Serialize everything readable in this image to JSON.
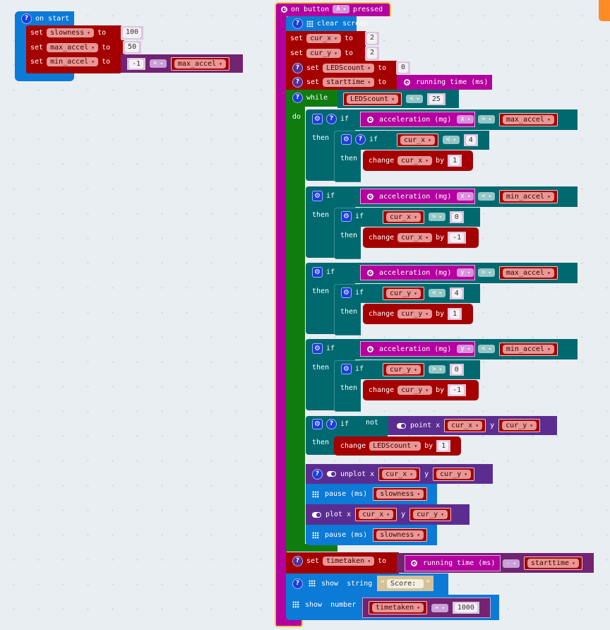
{
  "on_start": {
    "label": "on start",
    "statements": [
      {
        "keyword": "set",
        "var": "slowness",
        "to": "to",
        "value": "100"
      },
      {
        "keyword": "set",
        "var": "max_accel",
        "to": "to",
        "value": "50"
      },
      {
        "keyword": "set",
        "var": "min_accel",
        "to": "to",
        "left": "-1",
        "op": "×",
        "right_var": "max_accel"
      }
    ]
  },
  "on_button": {
    "prefix": "on button",
    "button": "A",
    "suffix": "pressed",
    "clear_screen": "clear screen",
    "set_cur_x": {
      "keyword": "set",
      "var": "cur_x",
      "to": "to",
      "value": "2"
    },
    "set_cur_y": {
      "keyword": "set",
      "var": "cur_y",
      "to": "to",
      "value": "2"
    },
    "set_leds": {
      "keyword": "set",
      "var": "LEDScount",
      "to": "to",
      "value": "0"
    },
    "set_start": {
      "keyword": "set",
      "var": "starttime",
      "to": "to",
      "value": "running time (ms)"
    },
    "while": {
      "keyword": "while",
      "var": "LEDScount",
      "op": "<",
      "value": "25",
      "do": "do"
    },
    "ifs": [
      {
        "if": "if",
        "sensor": "acceleration (mg)",
        "axis": "x",
        "op": ">",
        "cmp_var": "max_accel",
        "then": "then",
        "inner": {
          "if": "if",
          "var": "cur_x",
          "op": "<",
          "value": "4",
          "then": "then",
          "change": "change",
          "by": "by",
          "delta": "1"
        }
      },
      {
        "if": "if",
        "sensor": "acceleration (mg)",
        "axis": "x",
        "op": "<",
        "cmp_var": "min_accel",
        "then": "then",
        "inner": {
          "if": "if",
          "var": "cur_x",
          "op": ">",
          "value": "0",
          "then": "then",
          "change": "change",
          "by": "by",
          "delta": "-1"
        }
      },
      {
        "if": "if",
        "sensor": "acceleration (mg)",
        "axis": "y",
        "op": ">",
        "cmp_var": "max_accel",
        "then": "then",
        "inner": {
          "if": "if",
          "var": "cur_y",
          "op": "<",
          "value": "4",
          "then": "then",
          "change": "change",
          "by": "by",
          "delta": "1"
        }
      },
      {
        "if": "if",
        "sensor": "acceleration (mg)",
        "axis": "y",
        "op": "<",
        "cmp_var": "min_accel",
        "then": "then",
        "inner": {
          "if": "if",
          "var": "cur_y",
          "op": ">",
          "value": "0",
          "then": "then",
          "change": "change",
          "by": "by",
          "delta": "-1"
        }
      }
    ],
    "if_point": {
      "if": "if",
      "not": "not",
      "point": "point",
      "x_label": "x",
      "x_var": "cur_x",
      "y_label": "y",
      "y_var": "cur_y",
      "then": "then",
      "change": "change",
      "var": "LEDScount",
      "by": "by",
      "delta": "1"
    },
    "unplot": {
      "label": "unplot",
      "x_label": "x",
      "x_var": "cur_x",
      "y_label": "y",
      "y_var": "cur_y"
    },
    "pause1": {
      "label": "pause (ms)",
      "var": "slowness"
    },
    "plot": {
      "label": "plot",
      "x_label": "x",
      "x_var": "cur_x",
      "y_label": "y",
      "y_var": "cur_y"
    },
    "pause2": {
      "label": "pause (ms)",
      "var": "slowness"
    },
    "set_taken": {
      "keyword": "set",
      "var": "timetaken",
      "to": "to",
      "sensor": "running time (ms)",
      "op": "-",
      "right_var": "starttime"
    },
    "show_string": {
      "label": "show  string",
      "open_quote": "“",
      "value": "Score: ",
      "close_quote": "”"
    },
    "show_number": {
      "label": "show  number",
      "var": "timetaken",
      "op": "÷",
      "value": "1000"
    }
  }
}
